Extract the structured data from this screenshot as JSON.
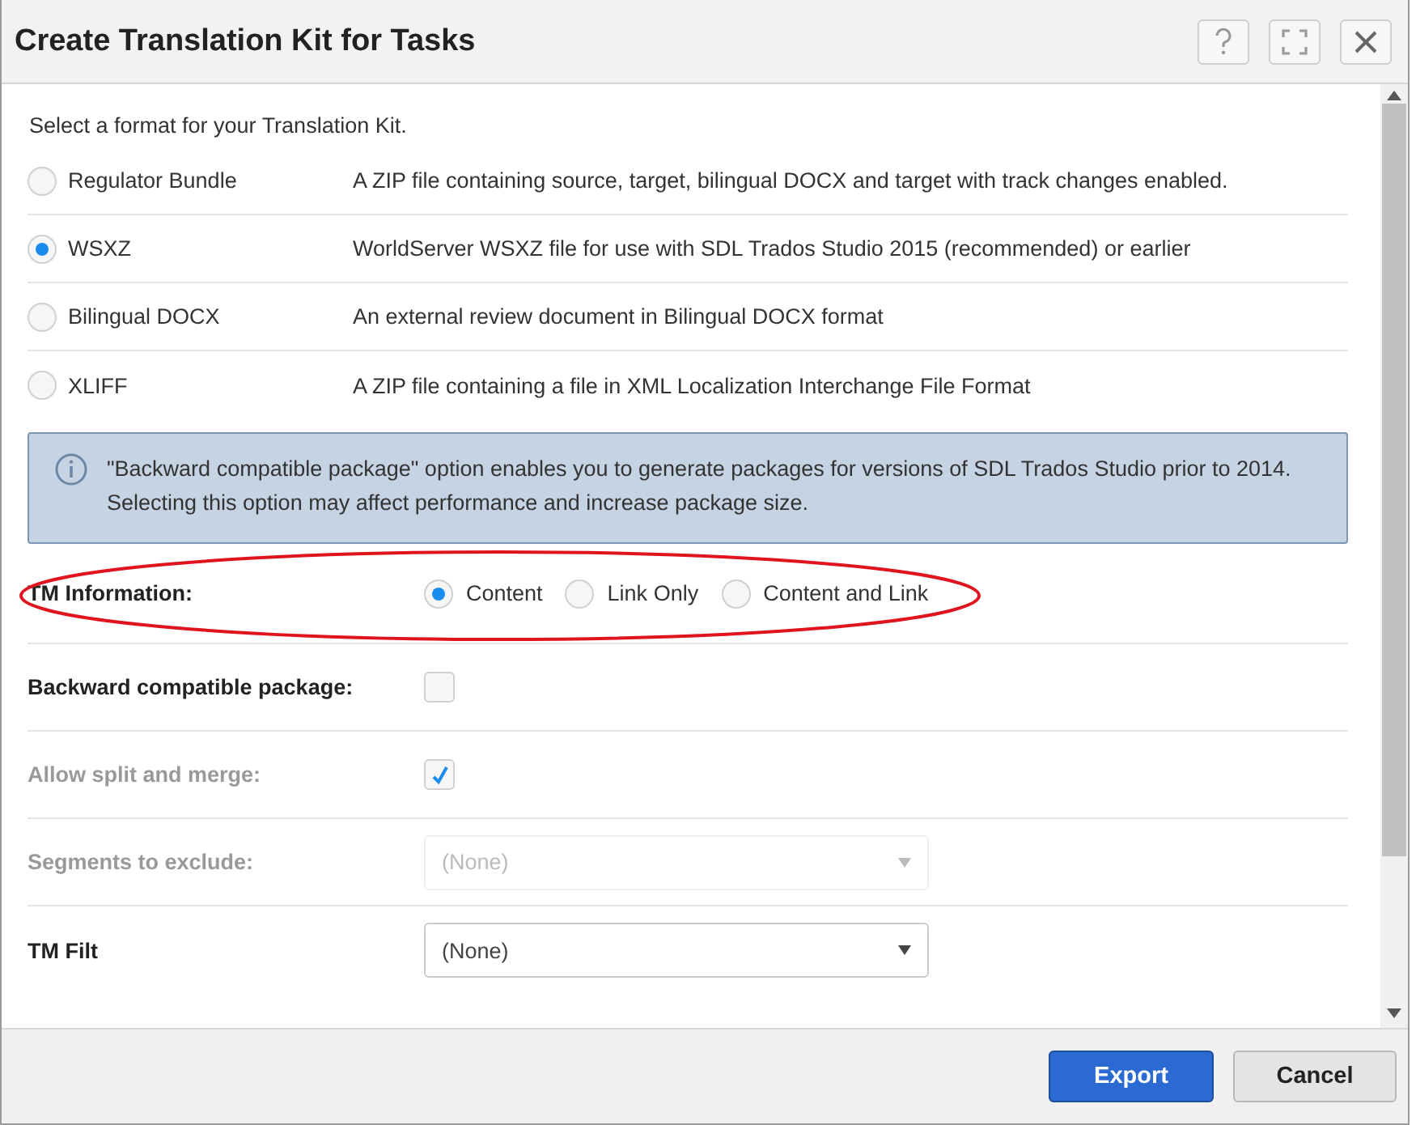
{
  "window": {
    "title": "Create Translation Kit for Tasks"
  },
  "intro": "Select a format for your Translation Kit.",
  "formats": [
    {
      "name": "Regulator Bundle",
      "description": "A ZIP file containing source, target, bilingual DOCX and target with track changes enabled.",
      "selected": false
    },
    {
      "name": "WSXZ",
      "description": "WorldServer WSXZ file for use with SDL Trados Studio 2015 (recommended) or earlier",
      "selected": true
    },
    {
      "name": "Bilingual DOCX",
      "description": "An external review document in Bilingual DOCX format",
      "selected": false
    },
    {
      "name": "XLIFF",
      "description": "A ZIP file containing a file in XML Localization Interchange File Format",
      "selected": false
    }
  ],
  "info": "\"Backward compatible package\" option enables you to generate packages for versions of SDL Trados Studio prior to 2014. Selecting this option may affect performance and increase package size.",
  "tm_information": {
    "label": "TM Information:",
    "options": [
      {
        "label": "Content",
        "selected": true
      },
      {
        "label": "Link Only",
        "selected": false
      },
      {
        "label": "Content and Link",
        "selected": false
      }
    ]
  },
  "fields": [
    {
      "kind": "checkbox",
      "label": "Backward compatible package:",
      "checked": false,
      "disabled": false
    },
    {
      "kind": "checkbox",
      "label": "Allow split and merge:",
      "checked": true,
      "disabled": true
    },
    {
      "kind": "select",
      "label": "Segments to exclude:",
      "value": "(None)",
      "disabled": true
    },
    {
      "kind": "select",
      "label": "TM Filt",
      "value": "(None)",
      "disabled": false
    }
  ],
  "buttons": [
    {
      "label": "Export",
      "kind": "primary"
    },
    {
      "label": "Cancel",
      "kind": "secondary"
    }
  ]
}
